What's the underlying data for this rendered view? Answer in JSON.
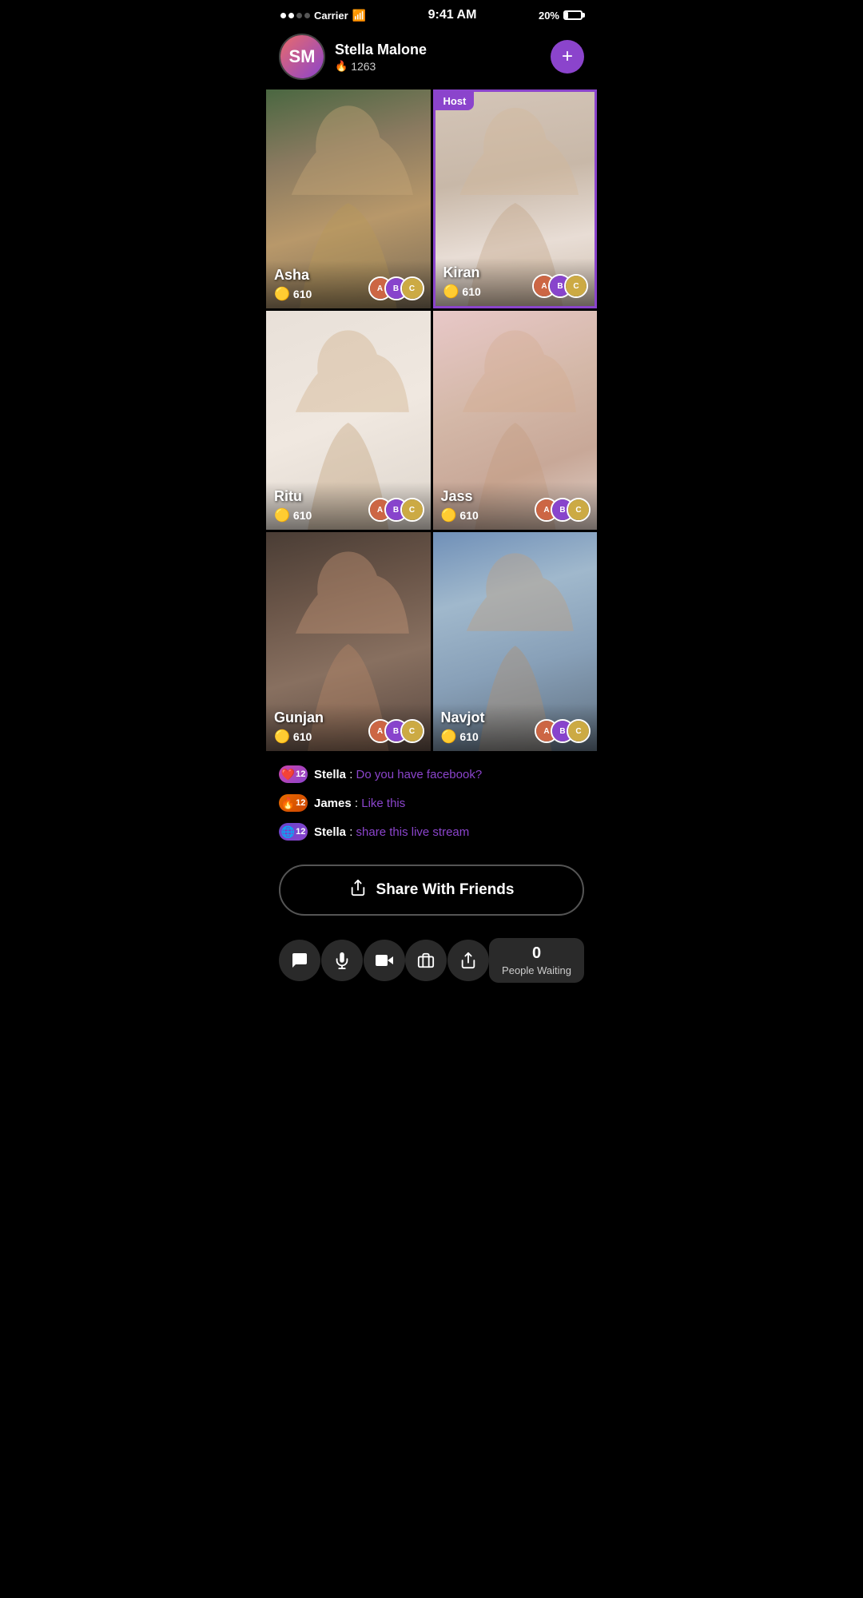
{
  "statusBar": {
    "carrier": "Carrier",
    "time": "9:41 AM",
    "battery": "20%"
  },
  "userHeader": {
    "name": "Stella Malone",
    "score": "1263",
    "plusLabel": "+"
  },
  "grid": {
    "cells": [
      {
        "id": "asha",
        "name": "Asha",
        "coins": "610",
        "isHost": false,
        "bgClass": "bg-asha",
        "avatarColors": [
          "#cc6644",
          "#8844cc",
          "#ccaa44"
        ]
      },
      {
        "id": "kiran",
        "name": "Kiran",
        "coins": "610",
        "isHost": true,
        "hostLabel": "Host",
        "bgClass": "bg-kiran",
        "avatarColors": [
          "#cc6644",
          "#8844cc",
          "#ccaa44"
        ]
      },
      {
        "id": "ritu",
        "name": "Ritu",
        "coins": "610",
        "isHost": false,
        "bgClass": "bg-ritu",
        "avatarColors": [
          "#cc6644",
          "#8844cc",
          "#ccaa44"
        ]
      },
      {
        "id": "jass",
        "name": "Jass",
        "coins": "610",
        "isHost": false,
        "bgClass": "bg-jass",
        "avatarColors": [
          "#cc6644",
          "#8844cc",
          "#ccaa44"
        ]
      },
      {
        "id": "gunjan",
        "name": "Gunjan",
        "coins": "610",
        "isHost": false,
        "bgClass": "bg-gunjan",
        "avatarColors": [
          "#cc6644",
          "#8844cc",
          "#ccaa44"
        ]
      },
      {
        "id": "navjot",
        "name": "Navjot",
        "coins": "610",
        "isHost": false,
        "bgClass": "bg-navjot",
        "avatarColors": [
          "#cc6644",
          "#8844cc",
          "#ccaa44"
        ]
      }
    ]
  },
  "chat": {
    "messages": [
      {
        "badgeType": "heart",
        "badgeNum": "12",
        "sender": "Stella",
        "text": "Do you have facebook?"
      },
      {
        "badgeType": "fire",
        "badgeNum": "12",
        "sender": "James",
        "text": "Like this"
      },
      {
        "badgeType": "planet",
        "badgeNum": "12",
        "sender": "Stella",
        "text": "share this live stream"
      }
    ]
  },
  "shareButton": {
    "label": "Share With Friends"
  },
  "bottomBar": {
    "buttons": [
      {
        "id": "chat",
        "icon": "💬"
      },
      {
        "id": "mic",
        "icon": "🎤"
      },
      {
        "id": "video",
        "icon": "🎥"
      },
      {
        "id": "wallet",
        "icon": "👛"
      },
      {
        "id": "share",
        "icon": "📤"
      }
    ],
    "peopleWaiting": {
      "count": "0",
      "label": "People Waiting"
    }
  }
}
